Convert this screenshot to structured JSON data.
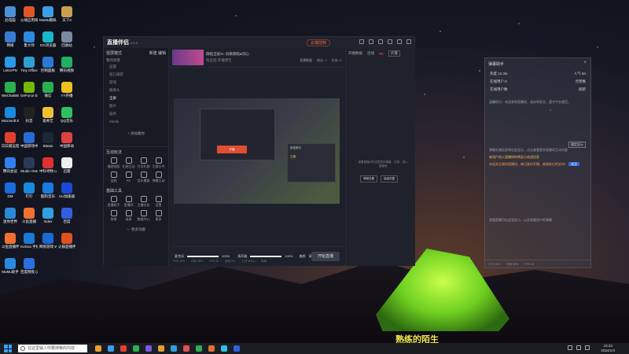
{
  "desktop": {
    "icons": [
      {
        "label": "此电脑",
        "color": "#4a8fd8"
      },
      {
        "label": "火绒应用商店",
        "color": "#e0562a"
      },
      {
        "label": "MuMu模拟器12",
        "color": "#39a0e8"
      },
      {
        "label": "天下3",
        "color": "#c8a050"
      },
      {
        "label": "网络",
        "color": "#3a7bd5"
      },
      {
        "label": "鲁大师",
        "color": "#2a8be0"
      },
      {
        "label": "GG浏览器",
        "color": "#18b6c8"
      },
      {
        "label": "回收站",
        "color": "#7a8aa0"
      },
      {
        "label": "LetsVPN",
        "color": "#2a9ae8"
      },
      {
        "label": "Tiny Office",
        "color": "#30a0d0"
      },
      {
        "label": "控制面板",
        "color": "#2a7ad5"
      },
      {
        "label": "腾讯视频",
        "color": "#20b060"
      },
      {
        "label": "WeChatWin...",
        "color": "#2ab050"
      },
      {
        "label": "GeForce Experience",
        "color": "#76b900"
      },
      {
        "label": "微信",
        "color": "#2ab050"
      },
      {
        "label": "YY开播",
        "color": "#f0c020"
      },
      {
        "label": "Microsoft Edge",
        "color": "#1a8ae0"
      },
      {
        "label": "抖音",
        "color": "#222"
      },
      {
        "label": "爱奇艺",
        "color": "#f0c030"
      },
      {
        "label": "QQ音乐",
        "color": "#30c060"
      },
      {
        "label": "向日葵远程控制",
        "color": "#e04030"
      },
      {
        "label": "中国游戏中心...",
        "color": "#2a6ad5"
      },
      {
        "label": "Steam",
        "color": "#1b2838"
      },
      {
        "label": "中国移动",
        "color": "#e04040"
      },
      {
        "label": "腾讯会议",
        "color": "#3080f0"
      },
      {
        "label": "Studio One 6",
        "color": "#2a3a5a"
      },
      {
        "label": "中科寻物 USBCa...",
        "color": "#e03030"
      },
      {
        "label": "迅雷",
        "color": "#eeeeee"
      },
      {
        "label": "DM",
        "color": "#1a6ae0"
      },
      {
        "label": "钉钉",
        "color": "#1a8ae0"
      },
      {
        "label": "酷狗音乐",
        "color": "#1a7ae0"
      },
      {
        "label": "UU加速器",
        "color": "#1a4ad5"
      },
      {
        "label": "迷你世界",
        "color": "#2a8ad5"
      },
      {
        "label": "斗鱼直播",
        "color": "#f07030"
      },
      {
        "label": "Index",
        "color": "#30a0e0"
      },
      {
        "label": "百度",
        "color": "#3060e0"
      },
      {
        "label": "斗鱼直播伴侣",
        "color": "#f07030"
      },
      {
        "label": "KoGoo 手机助手",
        "color": "#1a7ad5"
      },
      {
        "label": "网易游戏 WeGame",
        "color": "#1a6ad5"
      },
      {
        "label": "火锅直播伴侣",
        "color": "#e05020"
      },
      {
        "label": "MuMu助手",
        "color": "#2a8ae0"
      },
      {
        "label": "百度网盘 (2)",
        "color": "#2a70e0"
      }
    ]
  },
  "app": {
    "logo": "直播伴侣",
    "version": "6.5.5",
    "record_button": "云端控制",
    "left": {
      "scene_select": "竖屏模式",
      "scene_actions": [
        "新建",
        "编辑"
      ],
      "scene_header": "我的场景",
      "scenes": [
        "画面",
        "窗口捕获",
        "游戏",
        "摄像头",
        "全屏",
        "图片",
        "插件",
        "Media"
      ],
      "active_scene_index": 4,
      "add_material": "+ 添加素材",
      "interact_title": "互动玩法",
      "interact_tools": [
        "福袋抽奖",
        "礼物互动",
        "引导礼物",
        "大屏口令",
        "连线",
        "PK",
        "音乐播放",
        "弹幕互动"
      ],
      "basic_title": "基础工具",
      "basic_tools": [
        "直播助手",
        "直播间",
        "主播任务",
        "设置",
        "剪辑",
        "录屏",
        "数据中心",
        "更多"
      ],
      "more": "— 更多功能"
    },
    "room": {
      "title": "御弦王技%--剑来御弦&剑心",
      "stats": [
        "直播数据",
        "粉丝: 0",
        "在线: 0"
      ],
      "fans": "粉丝团",
      "level": "开播预告"
    },
    "preview": {
      "start_record_label": "开播",
      "dialog_title": "新建素材",
      "dialog_item": "主播"
    },
    "controls": {
      "mic_label": "麦克风",
      "mic_pct": "100%",
      "speaker_label": "扬声器",
      "speaker_pct": "100%",
      "start_button": "开始直播",
      "icons": [
        "美颜",
        "录制",
        "更多"
      ]
    },
    "statusbar": [
      "CPU 13%",
      "内存 38%",
      "FPS 30",
      "丢帧 0%",
      "上行 0Kb/s",
      "码率"
    ],
    "right": {
      "tabs": [
        "开播数据",
        "PK",
        "连线"
      ],
      "pk_label": "PK",
      "fold": "折叠",
      "empty_text": "观看直播可在这里显示弹幕、礼物、进入直播间",
      "buttons": [
        "弹幕设置",
        "高级设置"
      ]
    }
  },
  "assistant": {
    "title": "弹幕助手",
    "rows": [
      {
        "k": "热度 12.3w",
        "v": "人气 84"
      },
      {
        "k": "在线用户:0",
        "v": "点赞数"
      },
      {
        "k": "在线用户数",
        "v": "刷新"
      }
    ],
    "tips": [
      "温馨提示：欢迎来到直播间，请文明发言，遵守平台规范。",
      "弹幕礼物信息将在此显示，点击查看更多直播间互动内容",
      "新用户进入直播间时将显示欢迎信息",
      "欢迎关注我的直播间，每日准时开播，感谢各位的支持！"
    ],
    "follow_button": "关注",
    "pin": "固定显示",
    "footer_tip": "观看直播可在这里显示，以及观看用户的弹幕",
    "bottom": [
      "CPU 13%",
      "内存 38%",
      "FPS 30"
    ]
  },
  "subtitle": "熟练的陌生",
  "taskbar": {
    "search_placeholder": "在这里输入你要搜索的内容",
    "apps": [
      "#e8a030",
      "#3aa0e8",
      "#e04030",
      "#2ab050",
      "#7a5ae0",
      "#e0a030",
      "#30a0e0",
      "#e05050",
      "#2ab050",
      "#e07030",
      "#30c0e0",
      "#3060e0"
    ],
    "time": "19:33",
    "date": "2024/1/4"
  }
}
